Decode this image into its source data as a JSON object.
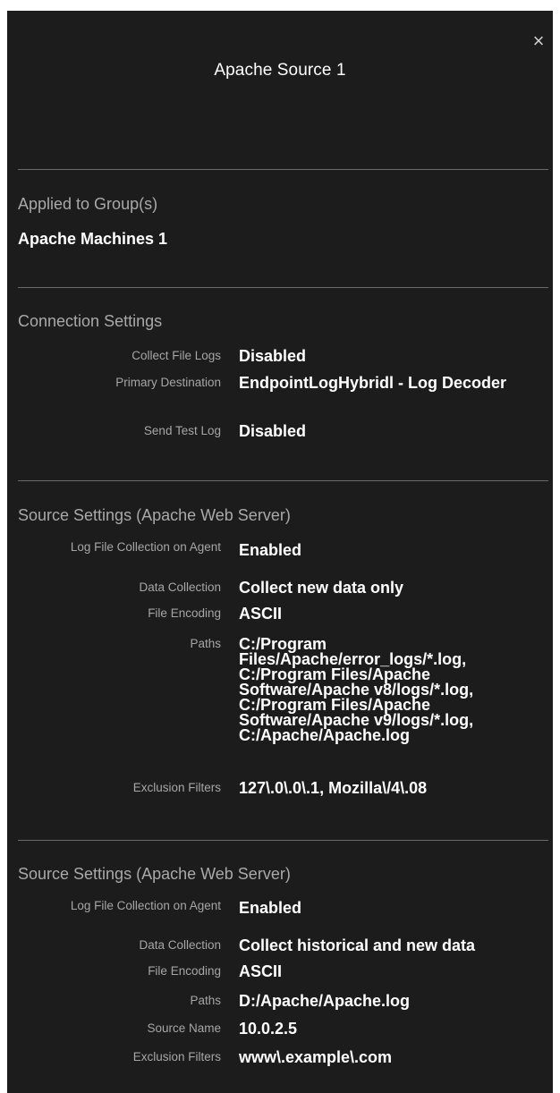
{
  "panel": {
    "title": "Apache Source 1",
    "close_label": "×"
  },
  "applied": {
    "heading": "Applied to Group(s)",
    "group": "Apache Machines 1"
  },
  "connection": {
    "heading": "Connection Settings",
    "rows": [
      {
        "label": "Collect File Logs",
        "value": "Disabled"
      },
      {
        "label": "Primary Destination",
        "value": "EndpointLogHybridl - Log Decoder"
      },
      {
        "label": "Send Test Log",
        "value": "Disabled"
      }
    ]
  },
  "source1": {
    "heading": "Source Settings (Apache Web Server)",
    "rows": [
      {
        "label": "Log File Collection on Agent",
        "value": "Enabled"
      },
      {
        "label": "Data Collection",
        "value": "Collect new data only"
      },
      {
        "label": "File Encoding",
        "value": "ASCII"
      },
      {
        "label": "Paths",
        "value": "C:/Program Files/Apache/error_logs/*.log, C:/Program Files/Apache Software/Apache v8/logs/*.log, C:/Program Files/Apache Software/Apache v9/logs/*.log, C:/Apache/Apache.log"
      },
      {
        "label": "Exclusion Filters",
        "value": "127\\.0\\.0\\.1, Mozilla\\/4\\.08"
      }
    ]
  },
  "source2": {
    "heading": "Source Settings (Apache Web Server)",
    "rows": [
      {
        "label": "Log File Collection on Agent",
        "value": "Enabled"
      },
      {
        "label": "Data Collection",
        "value": "Collect historical and new data"
      },
      {
        "label": "File Encoding",
        "value": "ASCII"
      },
      {
        "label": "Paths",
        "value": "D:/Apache/Apache.log"
      },
      {
        "label": "Source Name",
        "value": "10.0.2.5"
      },
      {
        "label": "Exclusion Filters",
        "value": "www\\.example\\.com"
      }
    ]
  }
}
